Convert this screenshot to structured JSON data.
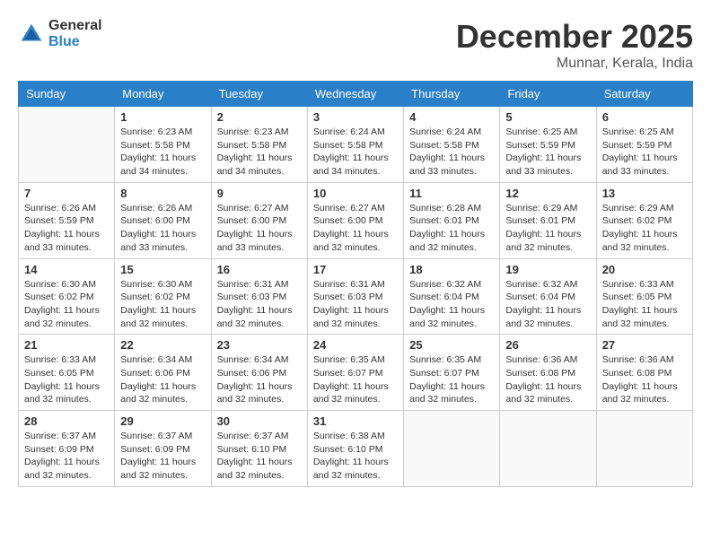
{
  "header": {
    "logo_general": "General",
    "logo_blue": "Blue",
    "month_title": "December 2025",
    "location": "Munnar, Kerala, India"
  },
  "columns": [
    "Sunday",
    "Monday",
    "Tuesday",
    "Wednesday",
    "Thursday",
    "Friday",
    "Saturday"
  ],
  "weeks": [
    [
      {
        "day": "",
        "info": ""
      },
      {
        "day": "1",
        "info": "Sunrise: 6:23 AM\nSunset: 5:58 PM\nDaylight: 11 hours and 34 minutes."
      },
      {
        "day": "2",
        "info": "Sunrise: 6:23 AM\nSunset: 5:58 PM\nDaylight: 11 hours and 34 minutes."
      },
      {
        "day": "3",
        "info": "Sunrise: 6:24 AM\nSunset: 5:58 PM\nDaylight: 11 hours and 34 minutes."
      },
      {
        "day": "4",
        "info": "Sunrise: 6:24 AM\nSunset: 5:58 PM\nDaylight: 11 hours and 33 minutes."
      },
      {
        "day": "5",
        "info": "Sunrise: 6:25 AM\nSunset: 5:59 PM\nDaylight: 11 hours and 33 minutes."
      },
      {
        "day": "6",
        "info": "Sunrise: 6:25 AM\nSunset: 5:59 PM\nDaylight: 11 hours and 33 minutes."
      }
    ],
    [
      {
        "day": "7",
        "info": "Sunrise: 6:26 AM\nSunset: 5:59 PM\nDaylight: 11 hours and 33 minutes."
      },
      {
        "day": "8",
        "info": "Sunrise: 6:26 AM\nSunset: 6:00 PM\nDaylight: 11 hours and 33 minutes."
      },
      {
        "day": "9",
        "info": "Sunrise: 6:27 AM\nSunset: 6:00 PM\nDaylight: 11 hours and 33 minutes."
      },
      {
        "day": "10",
        "info": "Sunrise: 6:27 AM\nSunset: 6:00 PM\nDaylight: 11 hours and 32 minutes."
      },
      {
        "day": "11",
        "info": "Sunrise: 6:28 AM\nSunset: 6:01 PM\nDaylight: 11 hours and 32 minutes."
      },
      {
        "day": "12",
        "info": "Sunrise: 6:29 AM\nSunset: 6:01 PM\nDaylight: 11 hours and 32 minutes."
      },
      {
        "day": "13",
        "info": "Sunrise: 6:29 AM\nSunset: 6:02 PM\nDaylight: 11 hours and 32 minutes."
      }
    ],
    [
      {
        "day": "14",
        "info": "Sunrise: 6:30 AM\nSunset: 6:02 PM\nDaylight: 11 hours and 32 minutes."
      },
      {
        "day": "15",
        "info": "Sunrise: 6:30 AM\nSunset: 6:02 PM\nDaylight: 11 hours and 32 minutes."
      },
      {
        "day": "16",
        "info": "Sunrise: 6:31 AM\nSunset: 6:03 PM\nDaylight: 11 hours and 32 minutes."
      },
      {
        "day": "17",
        "info": "Sunrise: 6:31 AM\nSunset: 6:03 PM\nDaylight: 11 hours and 32 minutes."
      },
      {
        "day": "18",
        "info": "Sunrise: 6:32 AM\nSunset: 6:04 PM\nDaylight: 11 hours and 32 minutes."
      },
      {
        "day": "19",
        "info": "Sunrise: 6:32 AM\nSunset: 6:04 PM\nDaylight: 11 hours and 32 minutes."
      },
      {
        "day": "20",
        "info": "Sunrise: 6:33 AM\nSunset: 6:05 PM\nDaylight: 11 hours and 32 minutes."
      }
    ],
    [
      {
        "day": "21",
        "info": "Sunrise: 6:33 AM\nSunset: 6:05 PM\nDaylight: 11 hours and 32 minutes."
      },
      {
        "day": "22",
        "info": "Sunrise: 6:34 AM\nSunset: 6:06 PM\nDaylight: 11 hours and 32 minutes."
      },
      {
        "day": "23",
        "info": "Sunrise: 6:34 AM\nSunset: 6:06 PM\nDaylight: 11 hours and 32 minutes."
      },
      {
        "day": "24",
        "info": "Sunrise: 6:35 AM\nSunset: 6:07 PM\nDaylight: 11 hours and 32 minutes."
      },
      {
        "day": "25",
        "info": "Sunrise: 6:35 AM\nSunset: 6:07 PM\nDaylight: 11 hours and 32 minutes."
      },
      {
        "day": "26",
        "info": "Sunrise: 6:36 AM\nSunset: 6:08 PM\nDaylight: 11 hours and 32 minutes."
      },
      {
        "day": "27",
        "info": "Sunrise: 6:36 AM\nSunset: 6:08 PM\nDaylight: 11 hours and 32 minutes."
      }
    ],
    [
      {
        "day": "28",
        "info": "Sunrise: 6:37 AM\nSunset: 6:09 PM\nDaylight: 11 hours and 32 minutes."
      },
      {
        "day": "29",
        "info": "Sunrise: 6:37 AM\nSunset: 6:09 PM\nDaylight: 11 hours and 32 minutes."
      },
      {
        "day": "30",
        "info": "Sunrise: 6:37 AM\nSunset: 6:10 PM\nDaylight: 11 hours and 32 minutes."
      },
      {
        "day": "31",
        "info": "Sunrise: 6:38 AM\nSunset: 6:10 PM\nDaylight: 11 hours and 32 minutes."
      },
      {
        "day": "",
        "info": ""
      },
      {
        "day": "",
        "info": ""
      },
      {
        "day": "",
        "info": ""
      }
    ]
  ]
}
